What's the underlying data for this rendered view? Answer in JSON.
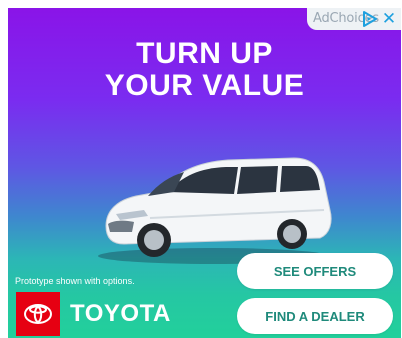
{
  "adchoices": {
    "label": "AdChoices",
    "close_symbol": "✕",
    "icon": "adchoices-triangle-icon"
  },
  "headline": {
    "line1": "TURN UP",
    "line2": "YOUR VALUE"
  },
  "disclaimer": "Prototype shown with options.",
  "brand": {
    "name": "TOYOTA",
    "logo_icon": "toyota-emblem-icon",
    "logo_bg": "#e60012"
  },
  "buttons": {
    "see_offers": "SEE OFFERS",
    "find_dealer": "FIND A DEALER"
  },
  "colors": {
    "gradient_top": "#8a14e8",
    "gradient_bottom": "#22d09b",
    "cta_text": "#1f8a7b"
  }
}
